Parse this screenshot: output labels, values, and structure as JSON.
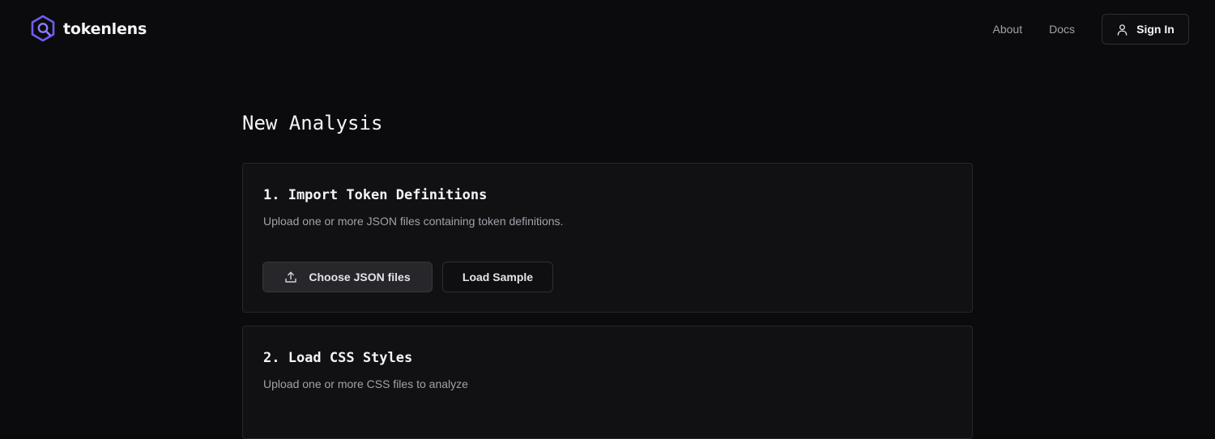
{
  "header": {
    "brand": "tokenlens",
    "nav": [
      {
        "label": "About"
      },
      {
        "label": "Docs"
      }
    ],
    "sign_in": "Sign In"
  },
  "icons": {
    "logo": "hexagon-search-icon",
    "user": "user-icon",
    "upload": "upload-icon"
  },
  "main": {
    "title": "New Analysis",
    "steps": [
      {
        "title": "1. Import Token Definitions",
        "description": "Upload one or more JSON files containing token definitions.",
        "primary_button": "Choose JSON files",
        "secondary_button": "Load Sample"
      },
      {
        "title": "2. Load CSS Styles",
        "description": "Upload one or more CSS files to analyze"
      }
    ]
  },
  "colors": {
    "background": "#0b0b0d",
    "card": "#111114",
    "accent": "#6d5df6",
    "text": "#f4f4f5",
    "muted": "#a1a1aa"
  }
}
